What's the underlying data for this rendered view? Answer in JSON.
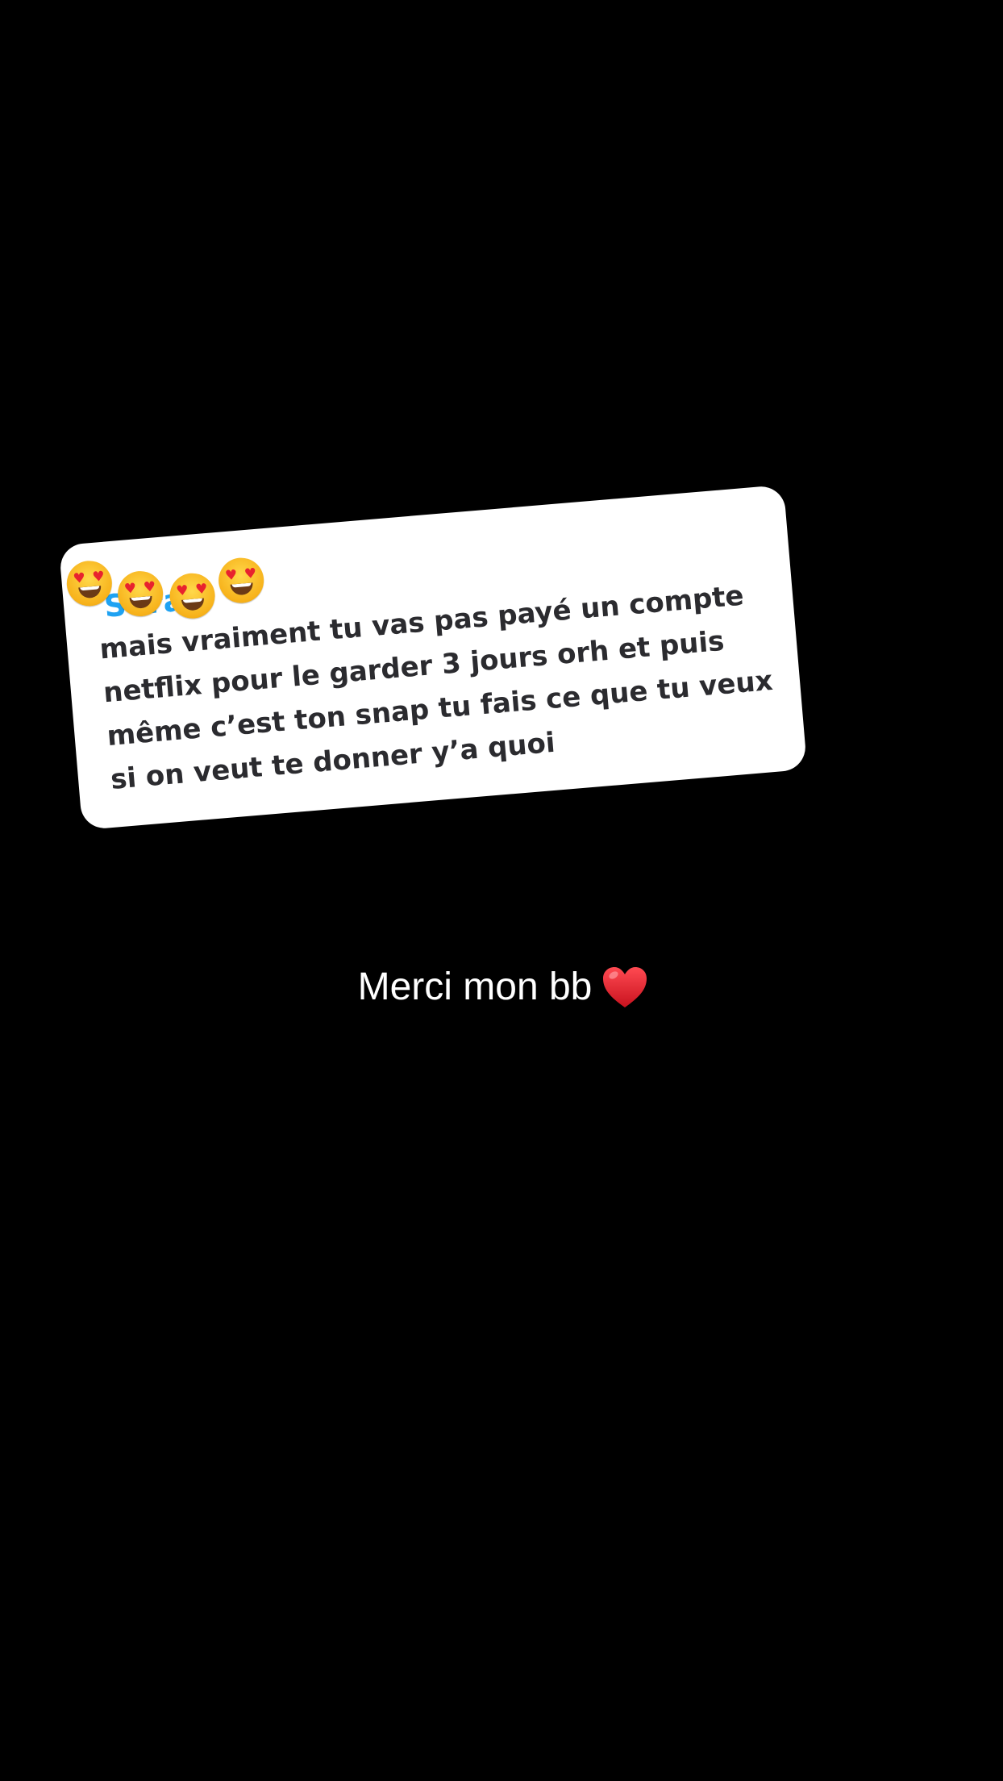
{
  "reply": {
    "sender_name": "Sarah",
    "message": "mais vraiment tu vas pas payé un compte netflix pour le garder 3 jours orh et puis même c’est ton snap tu fais ce que tu veux si on veut te donner y’a quoi",
    "emojis": [
      "heart-eyes-icon",
      "heart-eyes-icon",
      "heart-eyes-icon",
      "heart-eyes-icon"
    ]
  },
  "caption": {
    "text": "Merci mon bb",
    "icon": "red-heart-icon"
  },
  "colors": {
    "background": "#000000",
    "card": "#ffffff",
    "sender_name": "#1fa2f2",
    "message_text": "#2b2b2f",
    "caption_text": "#ffffff",
    "heart": "#e0202c"
  }
}
